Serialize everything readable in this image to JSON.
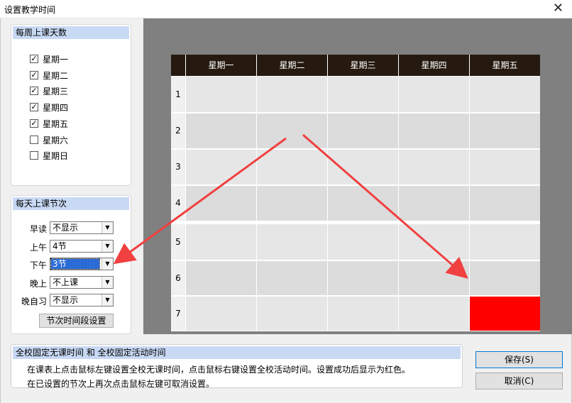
{
  "window": {
    "title": "设置教学时间"
  },
  "days_panel": {
    "title": "每周上课天数",
    "days": [
      {
        "label": "星期一",
        "checked": true
      },
      {
        "label": "星期二",
        "checked": true
      },
      {
        "label": "星期三",
        "checked": true
      },
      {
        "label": "星期四",
        "checked": true
      },
      {
        "label": "星期五",
        "checked": true
      },
      {
        "label": "星期六",
        "checked": false
      },
      {
        "label": "星期日",
        "checked": false
      }
    ]
  },
  "periods_panel": {
    "title": "每天上课节次",
    "rows": [
      {
        "label": "早读",
        "value": "不显示"
      },
      {
        "label": "上午",
        "value": "4节"
      },
      {
        "label": "下午",
        "value": "3节"
      },
      {
        "label": "晚上",
        "value": "不上课"
      },
      {
        "label": "晚自习",
        "value": "不显示"
      }
    ],
    "settings_button": "节次时间段设置"
  },
  "timetable": {
    "columns": [
      "星期一",
      "星期二",
      "星期三",
      "星期四",
      "星期五"
    ],
    "rows": [
      "1",
      "2",
      "3",
      "4",
      "5",
      "6",
      "7"
    ],
    "red_cells": [
      {
        "row": 7,
        "col": 5
      }
    ],
    "marked_color": "#ff0000"
  },
  "info": {
    "title": "全校固定无课时间 和 全校固定活动时间",
    "line1": "在课表上点击鼠标左键设置全校无课时间，点击鼠标右键设置全校活动时间。设置成功后显示为红色。",
    "line2": "在已设置的节次上再次点击鼠标左键可取消设置。"
  },
  "buttons": {
    "save": "保存(S)",
    "cancel": "取消(C)"
  },
  "colors": {
    "header_dark": "#261a10",
    "panel_header": "#c8d9f4",
    "annotation_arrow": "#f04040"
  }
}
